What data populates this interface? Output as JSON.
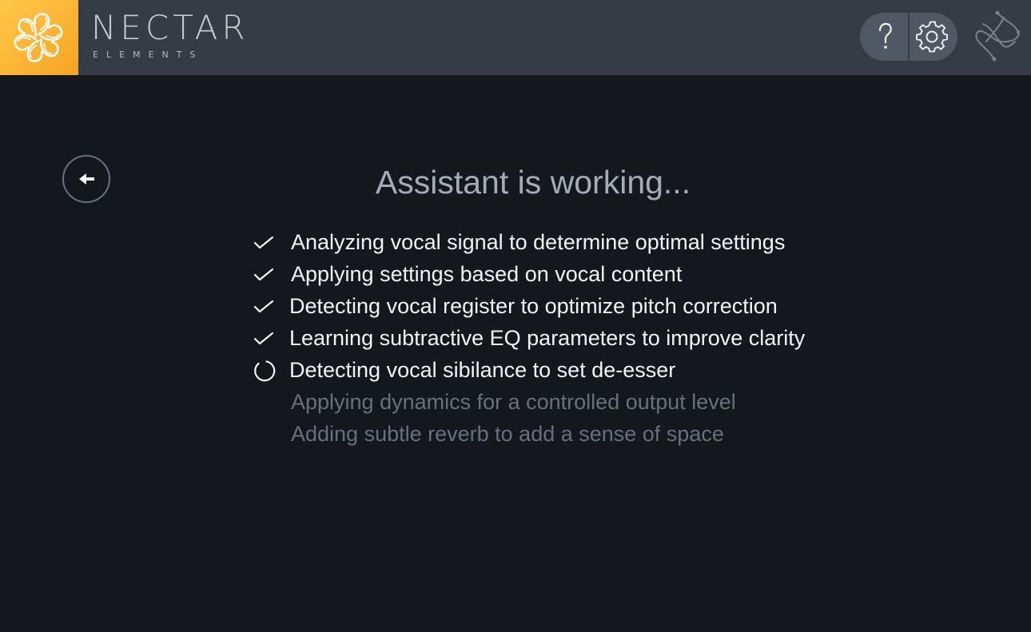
{
  "header": {
    "brand_name": "NECTAR",
    "brand_sub": "ELEMENTS",
    "logo_icon": "nectar-flower-logo",
    "help_icon": "question-icon",
    "settings_icon": "gear-icon",
    "company_icon": "izotope-logo",
    "colors": {
      "header_bg": "#353c46",
      "logo_gradient_start": "#ffc84a",
      "logo_gradient_end": "#f7a423",
      "button_bg": "#4f5863"
    }
  },
  "main": {
    "back_icon": "arrow-left-icon",
    "title": "Assistant is working...",
    "steps": [
      {
        "label": "Analyzing vocal signal to determine optimal settings",
        "status": "done",
        "icon": "check-icon"
      },
      {
        "label": "Applying settings based on vocal content",
        "status": "done",
        "icon": "check-icon"
      },
      {
        "label": "Detecting vocal register to optimize pitch correction",
        "status": "done",
        "icon": "check-icon"
      },
      {
        "label": "Learning subtractive EQ parameters to improve clarity",
        "status": "done",
        "icon": "check-icon"
      },
      {
        "label": "Detecting vocal sibilance to set de-esser",
        "status": "active",
        "icon": "spinner-icon"
      },
      {
        "label": "Applying dynamics for a controlled output level",
        "status": "pending",
        "icon": ""
      },
      {
        "label": "Adding subtle reverb to add a sense of space",
        "status": "pending",
        "icon": ""
      }
    ],
    "colors": {
      "background": "#14171b",
      "title_text": "#a7acb2",
      "done_text": "#f2f3f4",
      "pending_text": "#6b7078"
    }
  }
}
